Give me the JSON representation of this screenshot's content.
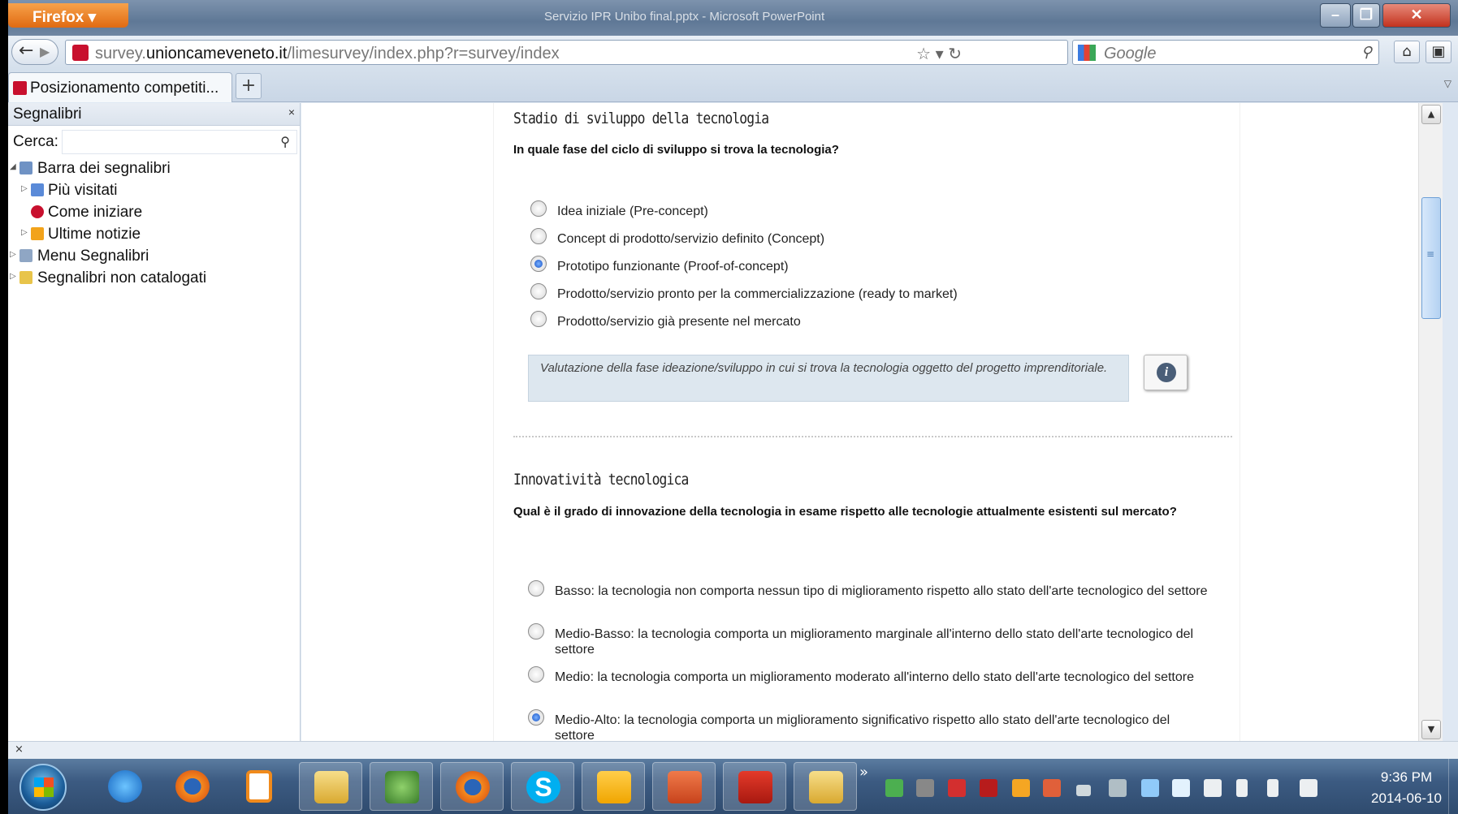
{
  "browser": {
    "app_button": "Firefox ▾",
    "window_title": "Servizio IPR Unibo final.pptx - Microsoft PowerPoint",
    "url_domain": "unioncameveneto.it",
    "url_prefix": "survey.",
    "url_path": "/limesurvey/index.php?r=survey/index",
    "search_engine_placeholder": "Google",
    "tab_title": "Posizionamento competiti...",
    "new_tab_label": "+"
  },
  "sidebar": {
    "title": "Segnalibri",
    "close_label": "×",
    "search_label": "Cerca:",
    "items": [
      {
        "label": "Barra dei segnalibri",
        "expanded": true,
        "icon": "bookmarks-toolbar-icon"
      },
      {
        "label": "Più visitati",
        "icon": "most-visited-icon"
      },
      {
        "label": "Come iniziare",
        "icon": "getting-started-icon"
      },
      {
        "label": "Ultime notizie",
        "icon": "rss-feed-icon"
      },
      {
        "label": "Menu Segnalibri",
        "icon": "bookmarks-menu-icon"
      },
      {
        "label": "Segnalibri non catalogati",
        "icon": "unsorted-bookmarks-icon"
      }
    ]
  },
  "survey": {
    "q1": {
      "title": "Stadio di sviluppo della tecnologia",
      "question": "In quale fase del ciclo di sviluppo si trova la tecnologia?",
      "options": [
        {
          "label": "Idea iniziale (Pre-concept)",
          "selected": false
        },
        {
          "label": "Concept di prodotto/servizio definito (Concept)",
          "selected": false
        },
        {
          "label": "Prototipo funzionante (Proof-of-concept)",
          "selected": true
        },
        {
          "label": "Prodotto/servizio pronto per la commercializzazione (ready to market)",
          "selected": false
        },
        {
          "label": "Prodotto/servizio già presente nel mercato",
          "selected": false
        }
      ],
      "help": "Valutazione della fase ideazione/sviluppo in cui si trova la tecnologia oggetto del progetto imprenditoriale."
    },
    "q2": {
      "title": "Innovatività tecnologica",
      "question": "Qual è il grado di innovazione della tecnologia in esame rispetto alle tecnologie attualmente esistenti sul mercato?",
      "options": [
        {
          "label": "Basso: la tecnologia non comporta nessun tipo di miglioramento rispetto allo stato dell'arte tecnologico del settore",
          "selected": false
        },
        {
          "label": "Medio-Basso: la tecnologia comporta un miglioramento marginale all'interno dello stato dell'arte tecnologico del settore",
          "selected": false
        },
        {
          "label": "Medio: la tecnologia comporta un miglioramento moderato all'interno dello stato dell'arte tecnologico del settore",
          "selected": false
        },
        {
          "label": "Medio-Alto: la tecnologia comporta un miglioramento significativo rispetto allo stato dell'arte tecnologico del settore",
          "selected": true
        }
      ]
    }
  },
  "taskbar": {
    "time": "9:36 PM",
    "date": "2014-06-10",
    "overflow_label": "»"
  },
  "colors": {
    "firefox_orange": "#e06a12",
    "radio_selected": "#1652c5",
    "help_bg": "#dde7ef"
  }
}
